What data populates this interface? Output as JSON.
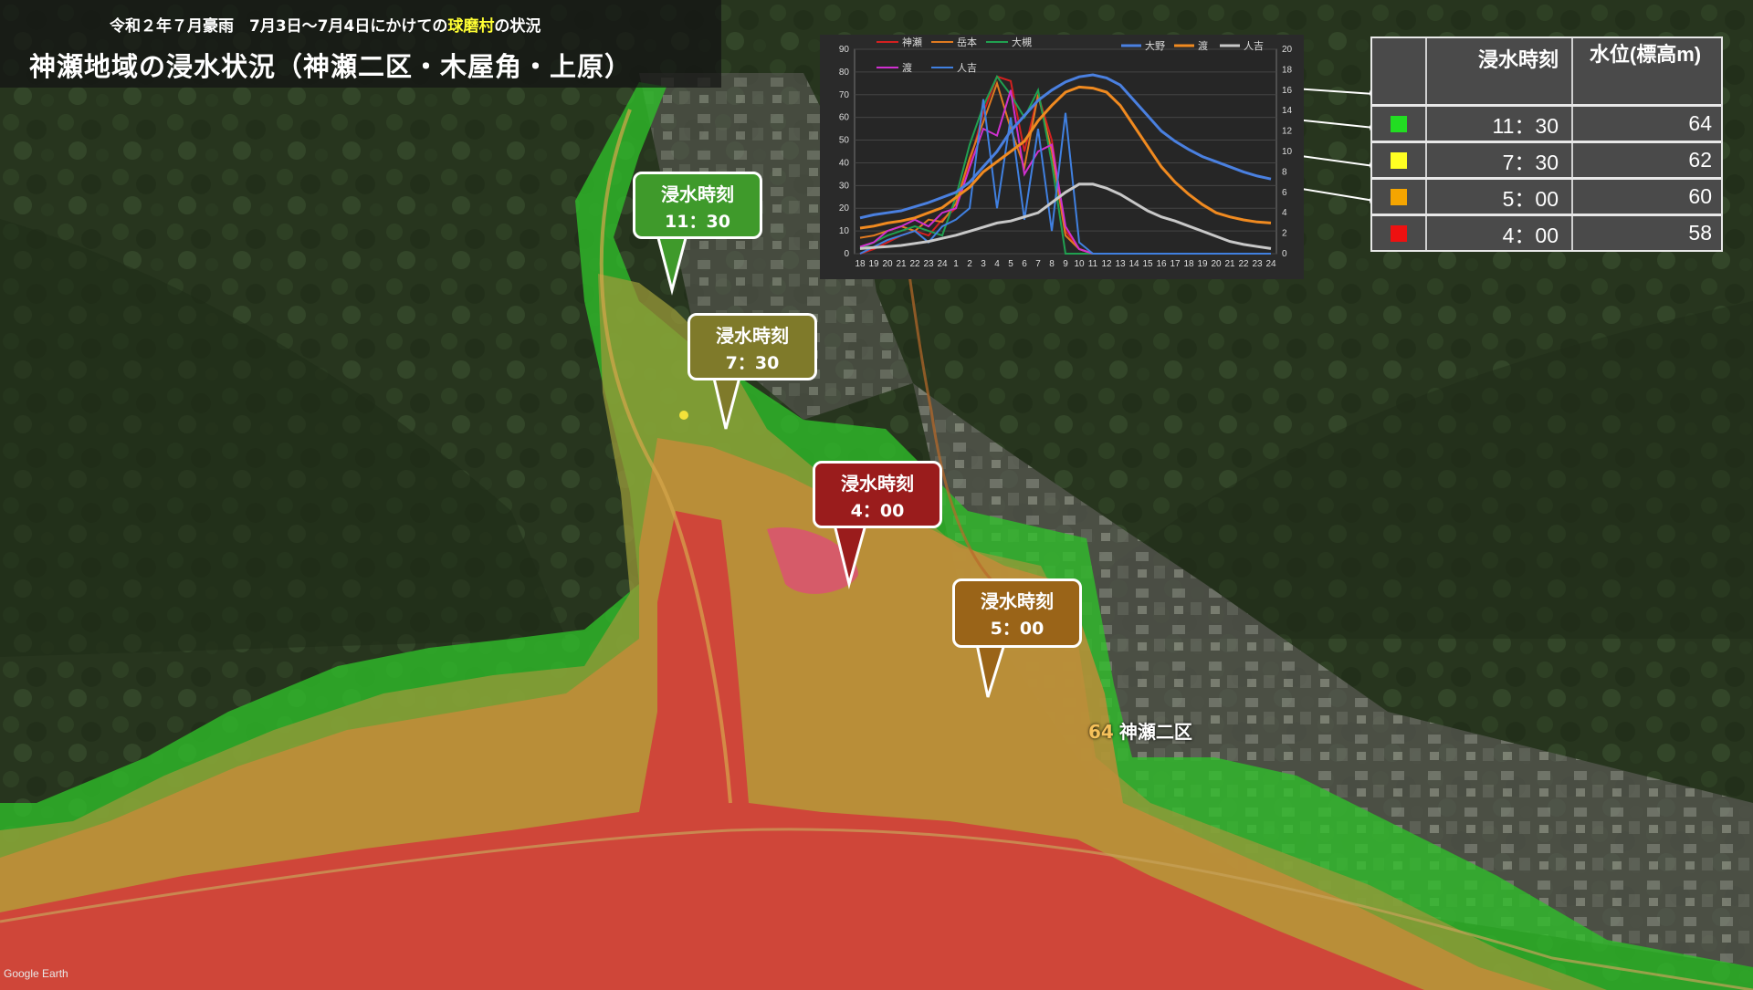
{
  "header": {
    "subtitle_prefix": "令和２年７月豪雨　7月3日～7月4日にかけての",
    "subtitle_highlight": "球磨村",
    "subtitle_suffix": "の状況",
    "title": "神瀬地域の浸水状況（神瀬二区・木屋角・上原）"
  },
  "callouts": [
    {
      "label": "浸水時刻",
      "time": "11：30",
      "color": "#3f9a2b"
    },
    {
      "label": "浸水時刻",
      "time": "7：30",
      "color": "#7f7a2a"
    },
    {
      "label": "浸水時刻",
      "time": "4：00",
      "color": "#9a1c1c"
    },
    {
      "label": "浸水時刻",
      "time": "5：00",
      "color": "#9a6418"
    }
  ],
  "place": {
    "number": "64",
    "name": "神瀬二区"
  },
  "attribution": "Google Earth",
  "legend": {
    "header_time": "浸水時刻",
    "header_level": "水位(標高m)",
    "rows": [
      {
        "color": "#22dd22",
        "time": "11：30",
        "level": "64"
      },
      {
        "color": "#ffff22",
        "time": "7：30",
        "level": "62"
      },
      {
        "color": "#f5a500",
        "time": "5：00",
        "level": "60"
      },
      {
        "color": "#ee1111",
        "time": "4：00",
        "level": "58"
      }
    ]
  },
  "chart_data": {
    "type": "line",
    "x": [
      "18",
      "19",
      "20",
      "21",
      "22",
      "23",
      "24",
      "1",
      "2",
      "3",
      "4",
      "5",
      "6",
      "7",
      "8",
      "9",
      "10",
      "11",
      "12",
      "13",
      "14",
      "15",
      "16",
      "17",
      "18",
      "19",
      "20",
      "21",
      "22",
      "23",
      "24"
    ],
    "ylim_left": [
      0,
      90
    ],
    "yticks_left": [
      0,
      10,
      20,
      30,
      40,
      50,
      60,
      70,
      80,
      90
    ],
    "ylim_right": [
      0,
      20
    ],
    "yticks_right": [
      0,
      2,
      4,
      6,
      8,
      10,
      12,
      14,
      16,
      18,
      20
    ],
    "legend_left": [
      {
        "name": "神瀬",
        "color": "#d42020"
      },
      {
        "name": "岳本",
        "color": "#e07a20"
      },
      {
        "name": "大槻",
        "color": "#20a050"
      },
      {
        "name": "渡",
        "color": "#d030d0"
      },
      {
        "name": "人吉",
        "color": "#4080e0"
      }
    ],
    "legend_right": [
      {
        "name": "大野",
        "color": "#4a80e0"
      },
      {
        "name": "渡",
        "color": "#f08a20"
      },
      {
        "name": "人吉",
        "color": "#c8c8c8"
      }
    ],
    "series": [
      {
        "name": "神瀬",
        "axis": "left",
        "color": "#d42020",
        "values": [
          0,
          2,
          5,
          8,
          10,
          8,
          15,
          20,
          40,
          62,
          78,
          76,
          45,
          70,
          50,
          10,
          2,
          0,
          0,
          0,
          0,
          0,
          0,
          0,
          0,
          0,
          0,
          0,
          0,
          0,
          0
        ]
      },
      {
        "name": "岳本",
        "axis": "left",
        "color": "#e07a20",
        "values": [
          7,
          8,
          10,
          12,
          10,
          15,
          14,
          22,
          42,
          58,
          75,
          55,
          38,
          70,
          45,
          8,
          2,
          0,
          0,
          0,
          0,
          0,
          0,
          0,
          0,
          0,
          0,
          0,
          0,
          0,
          0
        ]
      },
      {
        "name": "大槻",
        "axis": "left",
        "color": "#20a050",
        "values": [
          2,
          5,
          8,
          10,
          12,
          10,
          8,
          25,
          48,
          65,
          78,
          70,
          60,
          72,
          40,
          0,
          0,
          0,
          0,
          0,
          0,
          0,
          0,
          0,
          0,
          0,
          0,
          0,
          0,
          0,
          0
        ]
      },
      {
        "name": "渡",
        "axis": "left",
        "color": "#d030d0",
        "values": [
          3,
          5,
          10,
          12,
          15,
          12,
          18,
          20,
          38,
          55,
          52,
          72,
          35,
          45,
          48,
          12,
          2,
          0,
          0,
          0,
          0,
          0,
          0,
          0,
          0,
          0,
          0,
          0,
          0,
          0,
          0
        ]
      },
      {
        "name": "人吉",
        "axis": "left",
        "color": "#4080e0",
        "values": [
          0,
          3,
          6,
          8,
          10,
          5,
          12,
          15,
          20,
          68,
          20,
          60,
          15,
          55,
          10,
          62,
          5,
          0,
          0,
          0,
          0,
          0,
          0,
          0,
          0,
          0,
          0,
          0,
          0,
          0,
          0
        ]
      },
      {
        "name": "大野",
        "axis": "right",
        "color": "#4a80e0",
        "values": [
          3.5,
          3.8,
          4,
          4.2,
          4.6,
          5,
          5.5,
          6,
          7,
          8.5,
          10,
          12,
          13.5,
          15,
          16,
          16.8,
          17.3,
          17.5,
          17.2,
          16.5,
          15,
          13.5,
          12,
          11,
          10.2,
          9.5,
          9,
          8.5,
          8,
          7.6,
          7.3
        ]
      },
      {
        "name": "渡",
        "axis": "right",
        "color": "#f08a20",
        "values": [
          2.5,
          2.7,
          3,
          3.2,
          3.5,
          4,
          4.5,
          5.5,
          6.5,
          8,
          9,
          10,
          11,
          13,
          14.5,
          15.8,
          16.3,
          16.2,
          15.8,
          14.5,
          12.5,
          10.5,
          8.5,
          7,
          5.8,
          4.8,
          4,
          3.6,
          3.3,
          3.1,
          3
        ]
      },
      {
        "name": "人吉",
        "axis": "right",
        "color": "#c8c8c8",
        "values": [
          0.5,
          0.6,
          0.7,
          0.8,
          1,
          1.2,
          1.5,
          1.8,
          2.2,
          2.6,
          3,
          3.2,
          3.6,
          4,
          5,
          6,
          6.8,
          6.8,
          6.4,
          5.8,
          5,
          4.2,
          3.6,
          3.2,
          2.7,
          2.2,
          1.7,
          1.2,
          0.9,
          0.7,
          0.5
        ]
      }
    ]
  }
}
